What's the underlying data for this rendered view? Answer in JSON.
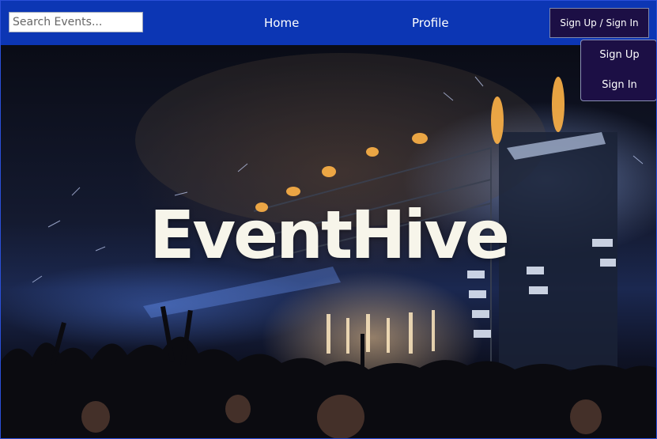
{
  "navbar": {
    "search_placeholder": "Search Events...",
    "home_label": "Home",
    "profile_label": "Profile",
    "auth_label": "Sign Up / Sign In"
  },
  "auth_dropdown": {
    "items": [
      "Sign Up",
      "Sign In"
    ]
  },
  "hero": {
    "brand_name": "EventHive",
    "background_description": "concert-crowd-stage-lights"
  },
  "colors": {
    "navbar_bg": "#0c36b4",
    "auth_button_bg": "#1c0f45",
    "brand_text": "#f7f5ea"
  }
}
